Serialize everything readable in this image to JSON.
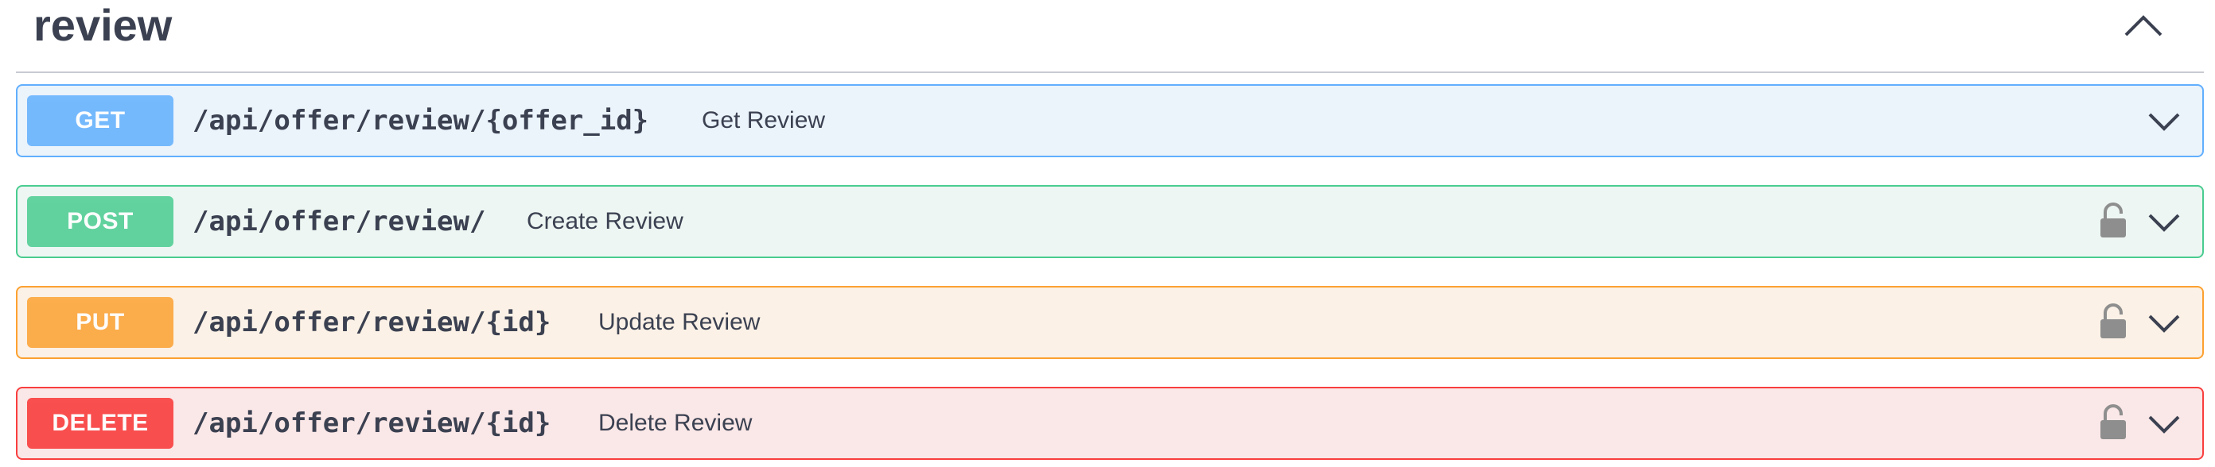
{
  "section": {
    "title": "review",
    "toggle_icon": "chevron-up-icon"
  },
  "operations": [
    {
      "method": "GET",
      "path": "/api/offer/review/{offer_id}",
      "summary": "Get Review",
      "locked": false,
      "color": "#61affe"
    },
    {
      "method": "POST",
      "path": "/api/offer/review/",
      "summary": "Create Review",
      "locked": true,
      "color": "#49cc90"
    },
    {
      "method": "PUT",
      "path": "/api/offer/review/{id}",
      "summary": "Update Review",
      "locked": true,
      "color": "#fca130"
    },
    {
      "method": "DELETE",
      "path": "/api/offer/review/{id}",
      "summary": "Delete Review",
      "locked": true,
      "color": "#f93e3e"
    }
  ],
  "icons": {
    "expand": "chevron-down-icon",
    "auth": "lock-icon"
  }
}
